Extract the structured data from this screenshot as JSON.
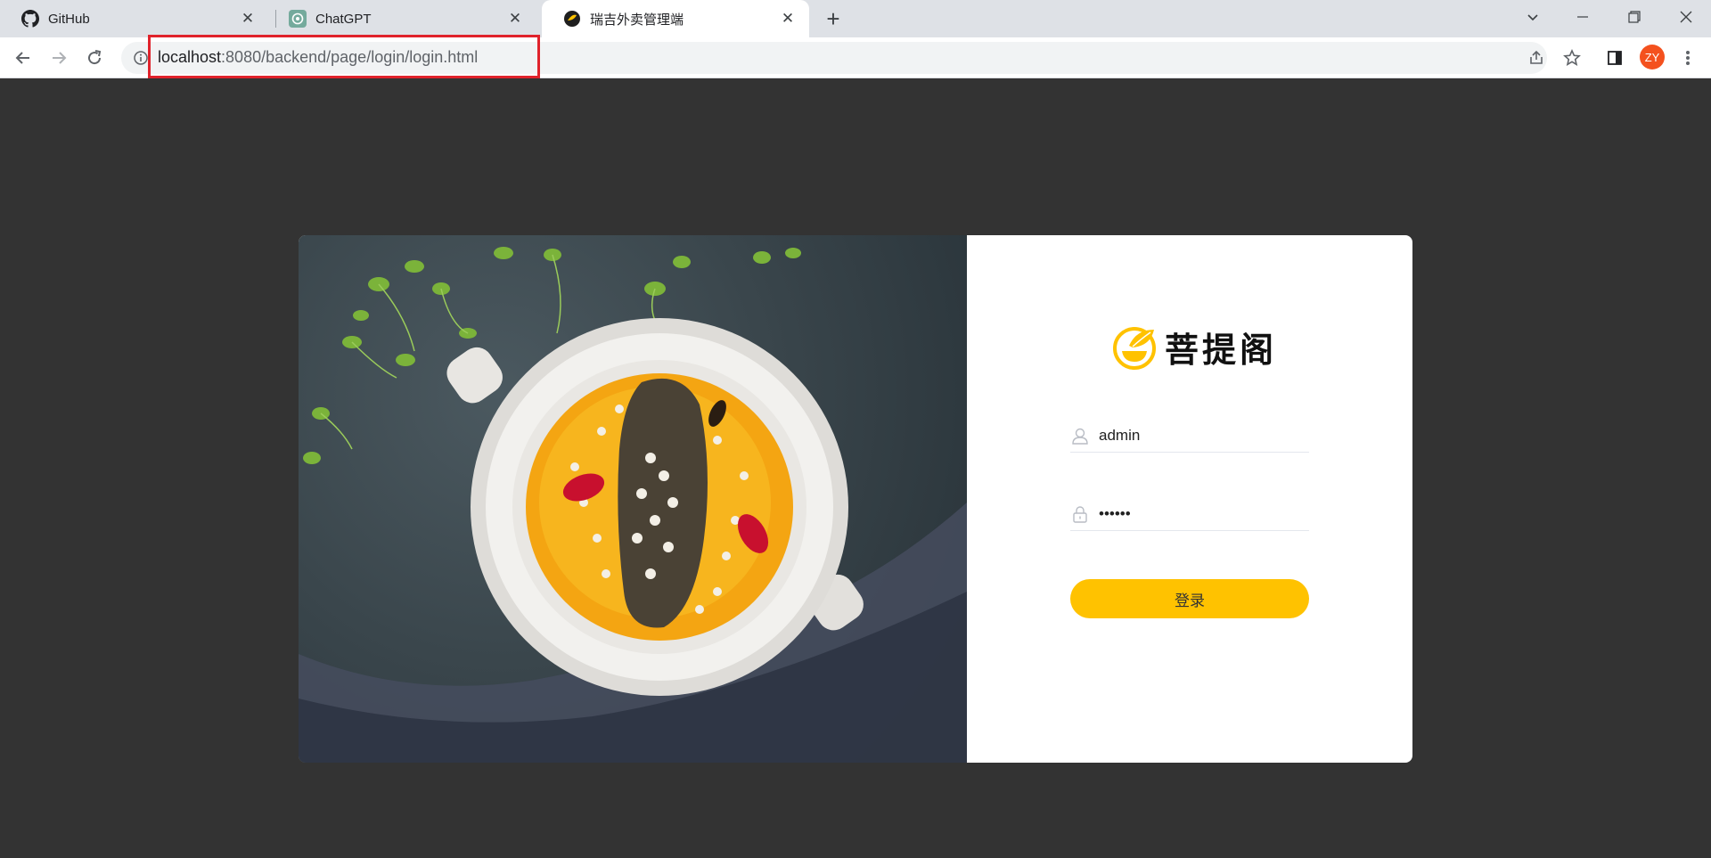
{
  "browser": {
    "tabs": [
      {
        "title": "GitHub",
        "icon": "github-icon"
      },
      {
        "title": "ChatGPT",
        "icon": "chatgpt-icon"
      },
      {
        "title": "瑞吉外卖管理端",
        "icon": "app-logo-icon",
        "active": true
      }
    ],
    "url": {
      "host": "localhost",
      "path": ":8080/backend/page/login/login.html"
    },
    "avatar_initials": "ZY",
    "colors": {
      "highlight_box": "#e0222b",
      "avatar_bg": "#f4511e"
    }
  },
  "login": {
    "logo_text": "菩提阁",
    "username_value": "admin",
    "password_value": "••••••",
    "button_label": "登录",
    "colors": {
      "accent": "#ffc200",
      "page_bg": "#333333"
    }
  }
}
